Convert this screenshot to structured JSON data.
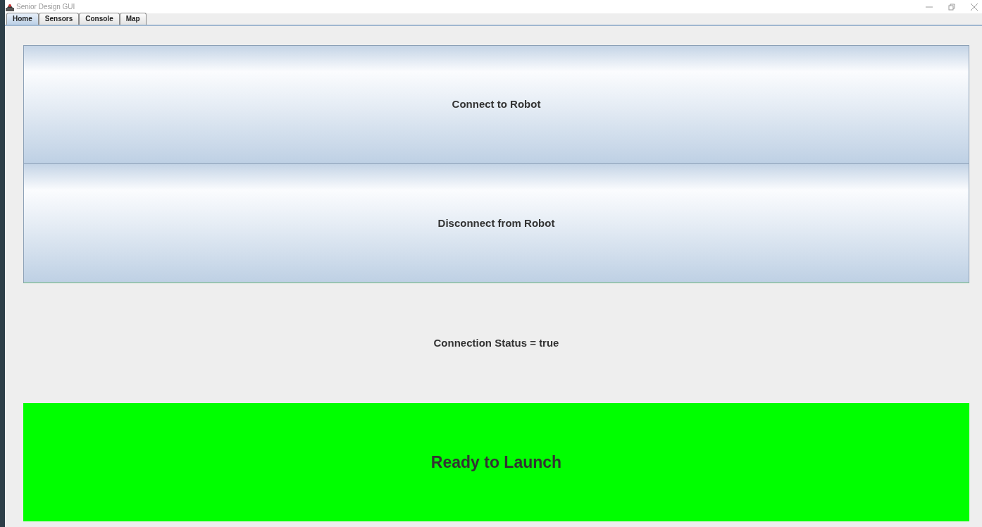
{
  "window": {
    "title": "Senior Design GUI"
  },
  "tabs": [
    {
      "label": "Home",
      "selected": true
    },
    {
      "label": "Sensors",
      "selected": false
    },
    {
      "label": "Console",
      "selected": false
    },
    {
      "label": "Map",
      "selected": false
    }
  ],
  "buttons": [
    {
      "label": "Connect to Robot"
    },
    {
      "label": "Disconnect from Robot"
    }
  ],
  "status": {
    "text": "Connection Status = true"
  },
  "launch_panel": {
    "text": "Ready to Launch",
    "ready": true
  }
}
